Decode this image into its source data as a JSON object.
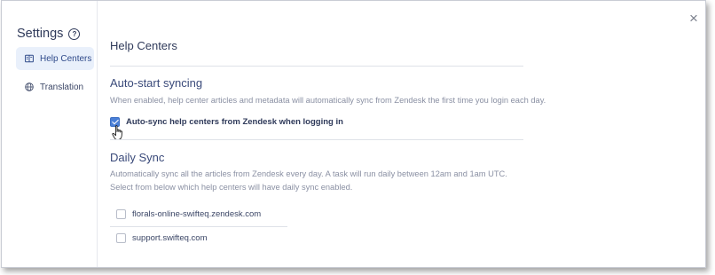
{
  "sidebar": {
    "title": "Settings",
    "help_glyph": "?",
    "items": [
      {
        "label": "Help Centers",
        "icon": "knowledge-base-icon",
        "active": true
      },
      {
        "label": "Translation",
        "icon": "globe-icon",
        "active": false
      }
    ]
  },
  "main": {
    "title": "Help Centers",
    "auto_start": {
      "title": "Auto-start syncing",
      "description": "When enabled, help center articles and metadata will automatically sync from Zendesk the first time you login each day.",
      "checkbox_label": "Auto-sync help centers from Zendesk when logging in",
      "checked": true
    },
    "daily_sync": {
      "title": "Daily Sync",
      "description_line1": "Automatically sync all the articles from Zendesk every day. A task will run daily between 12am and 1am UTC.",
      "description_line2": "Select from below which help centers will have daily sync enabled.",
      "help_centers": [
        {
          "label": "florals-online-swifteq.zendesk.com",
          "checked": false
        },
        {
          "label": "support.swifteq.com",
          "checked": false
        }
      ]
    }
  },
  "close_glyph": "×",
  "colors": {
    "accent": "#4a7fd6",
    "active_nav_bg": "#e9f0fb",
    "text_primary": "#2f3a5a",
    "text_muted": "#8a90a3"
  }
}
